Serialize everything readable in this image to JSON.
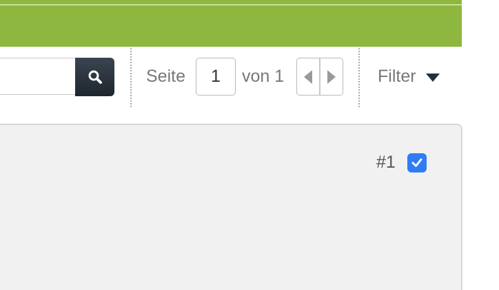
{
  "pager": {
    "page_label": "Seite",
    "current_page": "1",
    "of_label": "von 1"
  },
  "filter": {
    "label": "Filter"
  },
  "item": {
    "number_label": "#1",
    "checked": true
  },
  "icons": {
    "search": "search-icon",
    "prev": "triangle-left-icon",
    "next": "triangle-right-icon",
    "filter": "caret-down-icon",
    "check": "checkmark-icon"
  },
  "colors": {
    "header_green": "#8db73e",
    "search_button": "#2a323b",
    "checkbox_blue": "#2f7cf6",
    "panel_background": "#f1f1f1",
    "text_gray": "#777777"
  }
}
